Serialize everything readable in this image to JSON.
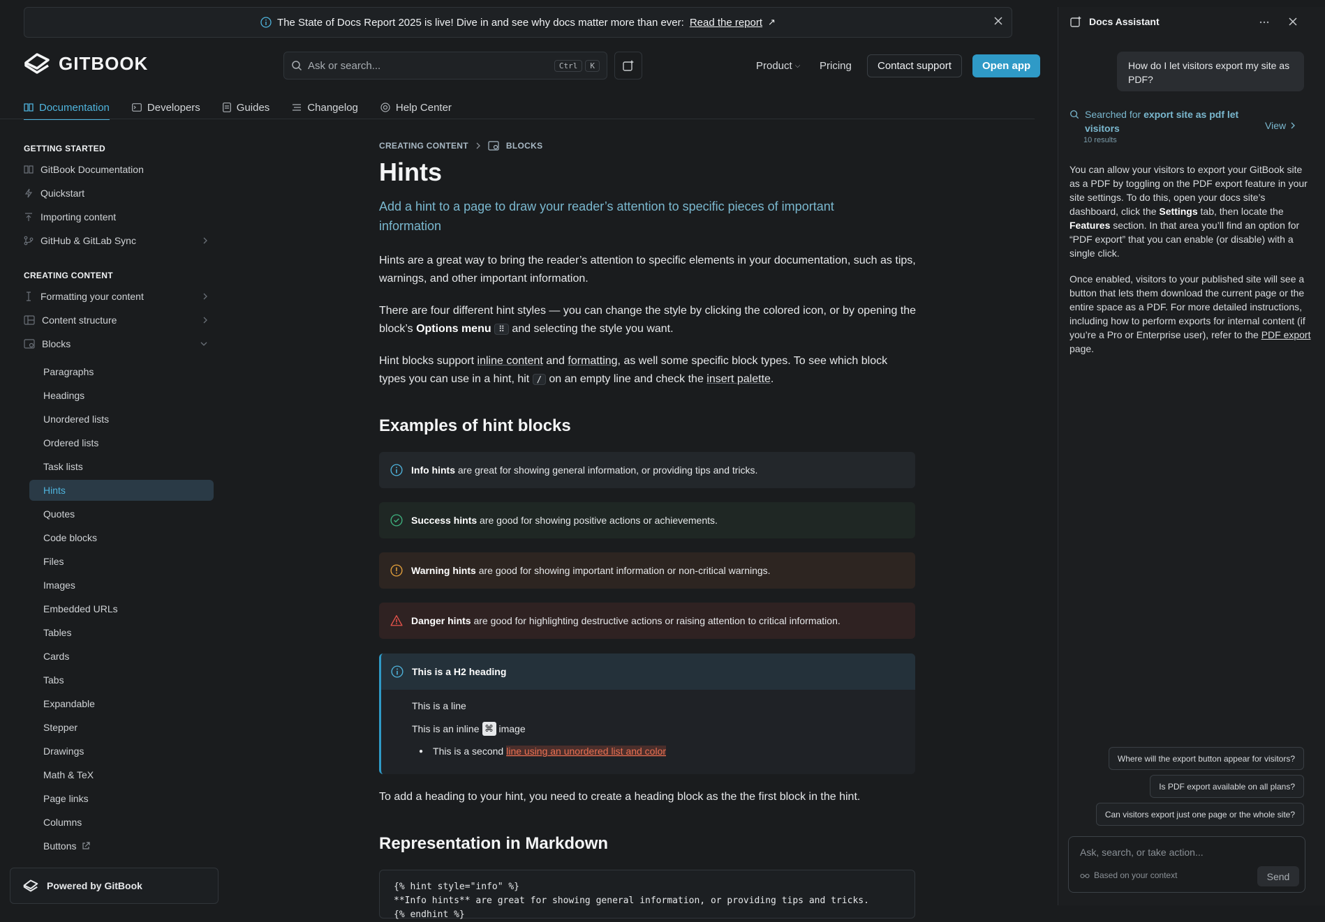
{
  "banner": {
    "text": "The State of Docs Report 2025 is live! Dive in and see why docs matter more than ever:",
    "link": "Read the report",
    "arrow": "↗"
  },
  "header": {
    "logo": "GITBOOK",
    "search_placeholder": "Ask or search...",
    "kbd": [
      "Ctrl",
      "K"
    ],
    "nav": [
      "Product",
      "Pricing"
    ],
    "contact": "Contact support",
    "open_app": "Open app"
  },
  "tabs": [
    "Documentation",
    "Developers",
    "Guides",
    "Changelog",
    "Help Center"
  ],
  "sidebar": {
    "sec1": "GETTING STARTED",
    "items1": [
      "GitBook Documentation",
      "Quickstart",
      "Importing content",
      "GitHub & GitLab Sync"
    ],
    "sec2": "CREATING CONTENT",
    "items2": [
      "Formatting your content",
      "Content structure",
      "Blocks"
    ],
    "blocks": [
      "Paragraphs",
      "Headings",
      "Unordered lists",
      "Ordered lists",
      "Task lists",
      "Hints",
      "Quotes",
      "Code blocks",
      "Files",
      "Images",
      "Embedded URLs",
      "Tables",
      "Cards",
      "Tabs",
      "Expandable",
      "Stepper",
      "Drawings",
      "Math & TeX",
      "Page links",
      "Columns",
      "Buttons"
    ],
    "powered": "Powered by GitBook"
  },
  "main": {
    "crumb": [
      "CREATING CONTENT",
      "BLOCKS"
    ],
    "title": "Hints",
    "lead": "Add a hint to a page to draw your reader’s attention to specific pieces of important information",
    "p1": "Hints are a great way to bring the reader’s attention to specific elements in your documentation, such as tips, warnings, and other important information.",
    "p2a": "There are four different hint styles — you can change the style by clicking the colored icon, or by opening the block’s ",
    "p2b": "Options menu",
    "p2c": " and selecting the style you want.",
    "p3a": "Hint blocks support ",
    "p3b": "inline content",
    "p3c": " and ",
    "p3d": "formatting",
    "p3e": ", as well some specific block types. To see which block types you can use in a hint, hit ",
    "p3f": "/",
    "p3g": " on an empty line and check the ",
    "p3h": "insert palette",
    "p3i": ".",
    "h2a": "Examples of hint blocks",
    "hints": [
      {
        "b": "Info hints",
        "t": " are great for showing general information, or providing tips and tricks."
      },
      {
        "b": "Success hints",
        "t": " are good for showing positive actions or achievements."
      },
      {
        "b": "Warning hints",
        "t": " are good for showing important information or non-critical warnings."
      },
      {
        "b": "Danger hints",
        "t": " are good for highlighting destructive actions or raising attention to critical information."
      }
    ],
    "h2hint": {
      "heading": "This is a H2 heading",
      "line1": "This is a line",
      "line2a": "This is an inline",
      "line2b": "image",
      "line3a": "This is a second",
      "line3b": "line using an unordered list and color"
    },
    "p4": "To add a heading to your hint, you need to create a heading block as the the first block in the hint.",
    "h2b": "Representation in Markdown",
    "code": "{% hint style=\"info\" %}\n**Info hints** are great for showing general information, or providing tips and tricks.\n{% endhint %}"
  },
  "assistant": {
    "title": "Docs Assistant",
    "user_msg": "How do I let visitors export my site as PDF?",
    "searched_prefix": "Searched for",
    "searched_query": "export site as pdf let visitors",
    "view": "View",
    "results": "10 results",
    "ans1a": "You can allow your visitors to export your GitBook site as a PDF by toggling on the PDF export feature in your site settings. To do this, open your docs site’s dashboard, click the ",
    "ans1b": "Settings",
    "ans1c": " tab, then locate the ",
    "ans1d": "Features",
    "ans1e": " section. In that area you’ll find an option for “PDF export” that you can enable (or disable) with a single click.",
    "ans2a": "Once enabled, visitors to your published site will see a button that lets them download the current page or the entire space as a PDF. For more detailed instructions, including how to perform exports for internal content (if you’re a Pro or Enterprise user), refer to the ",
    "ans2b": "PDF export",
    "ans2c": " page.",
    "suggestions": [
      "Where will the export button appear for visitors?",
      "Is PDF export available on all plans?",
      "Can visitors export just one page or the whole site?"
    ],
    "input_placeholder": "Ask, search, or take action...",
    "context": "Based on your context",
    "send": "Send"
  },
  "colors": {
    "accent": "#2f9ac7",
    "info": "#4fb4dd",
    "success": "#3fb27f",
    "warning": "#e6a23c",
    "danger": "#e5534b"
  }
}
